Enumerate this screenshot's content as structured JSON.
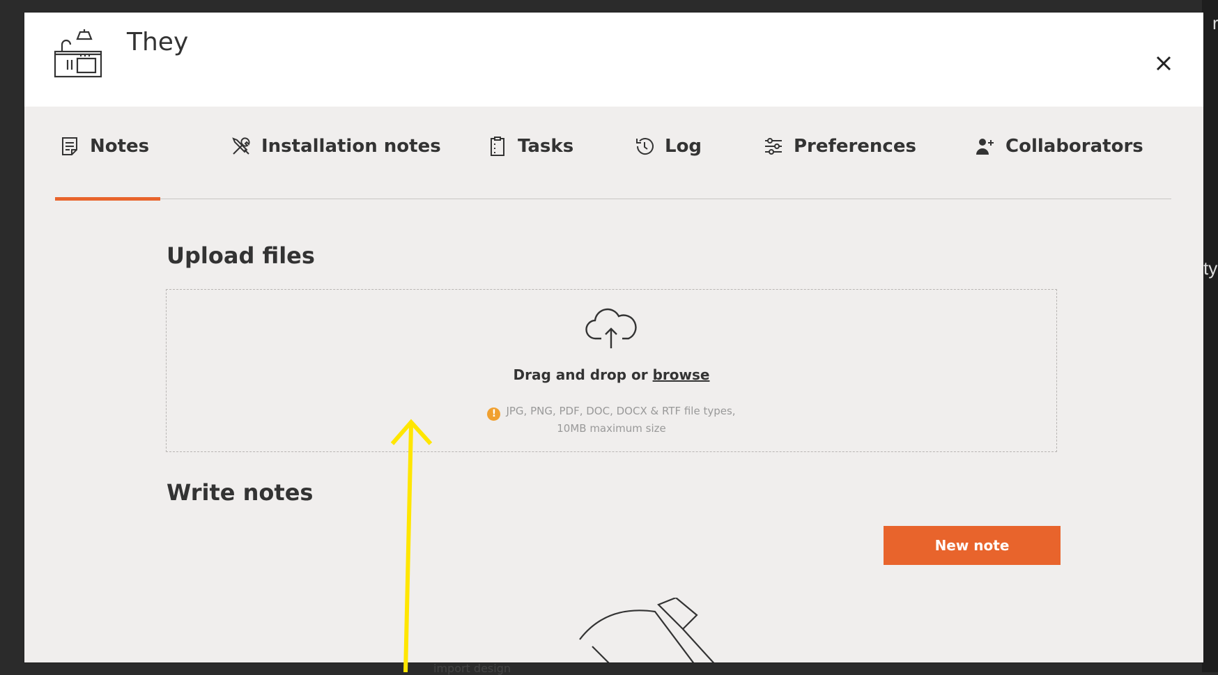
{
  "backdrop": {
    "edge_text_top": "r",
    "edge_text_mid": "ty",
    "behind_text": "import design"
  },
  "header": {
    "title": "They",
    "project_icon": "kitchen-icon",
    "close_icon": "close-icon"
  },
  "tabs": [
    {
      "label": "Notes",
      "icon": "notes-icon",
      "active": true
    },
    {
      "label": "Installation notes",
      "icon": "tools-icon",
      "active": false
    },
    {
      "label": "Tasks",
      "icon": "clipboard-icon",
      "active": false
    },
    {
      "label": "Log",
      "icon": "history-icon",
      "active": false
    },
    {
      "label": "Preferences",
      "icon": "sliders-icon",
      "active": false
    },
    {
      "label": "Collaborators",
      "icon": "add-user-icon",
      "active": false
    }
  ],
  "upload": {
    "title": "Upload files",
    "drag_text": "Drag and drop or",
    "browse_label": "browse",
    "filetypes_line1": "JPG, PNG, PDF, DOC, DOCX & RTF file types,",
    "filetypes_line2": "10MB maximum size",
    "warn_glyph": "!"
  },
  "notes": {
    "title": "Write notes",
    "new_note_label": "New note"
  },
  "colors": {
    "accent": "#e8642c",
    "warning": "#f0a030",
    "annotation": "#ffe600"
  }
}
